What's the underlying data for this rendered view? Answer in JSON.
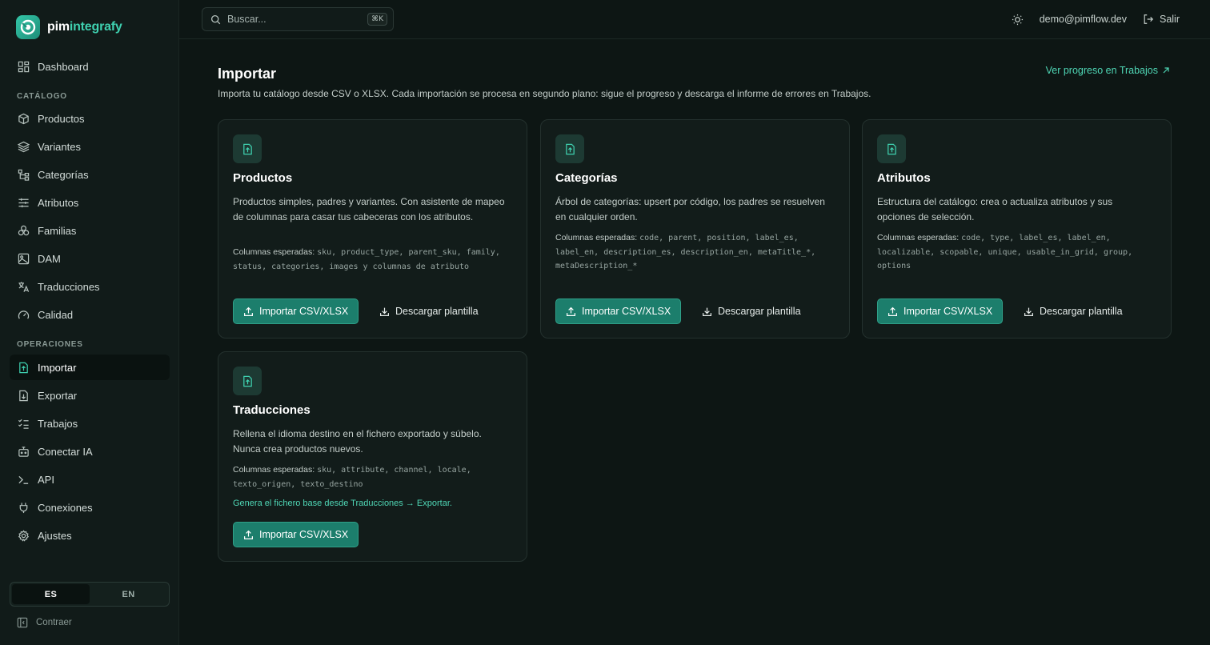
{
  "app": {
    "brand_a": "pim",
    "brand_b": "integrafy"
  },
  "sidebar": {
    "dashboard": "Dashboard",
    "section_catalog": "CATÁLOGO",
    "catalog_items": [
      "Productos",
      "Variantes",
      "Categorías",
      "Atributos",
      "Familias",
      "DAM",
      "Traducciones",
      "Calidad"
    ],
    "section_ops": "OPERACIONES",
    "ops_items": [
      "Importar",
      "Exportar",
      "Trabajos",
      "Conectar IA",
      "API",
      "Conexiones",
      "Ajustes"
    ],
    "active_item": "Importar",
    "lang": {
      "es": "ES",
      "en": "EN",
      "selected": "ES"
    },
    "collapse_label": "Contraer"
  },
  "topbar": {
    "search_placeholder": "Buscar...",
    "search_shortcut": "⌘K",
    "user_email": "demo@pimflow.dev",
    "logout_label": "Salir"
  },
  "page": {
    "title": "Importar",
    "description": "Importa tu catálogo desde CSV o XLSX. Cada importación se procesa en segundo plano: sigue el progreso y descarga el informe de errores en Trabajos.",
    "progress_link": "Ver progreso en Trabajos"
  },
  "cards": [
    {
      "title": "Productos",
      "description": "Productos simples, padres y variantes. Con asistente de mapeo de columnas para casar tus cabeceras con los atributos.",
      "columns_label": "Columnas esperadas:",
      "columns": "sku, product_type, parent_sku, family, status, categories, images y columnas de atributo",
      "import_label": "Importar CSV/XLSX",
      "template_label": "Descargar plantilla"
    },
    {
      "title": "Categorías",
      "description": "Árbol de categorías: upsert por código, los padres se resuelven en cualquier orden.",
      "columns_label": "Columnas esperadas:",
      "columns": "code, parent, position, label_es, label_en, description_es, description_en, metaTitle_*, metaDescription_*",
      "import_label": "Importar CSV/XLSX",
      "template_label": "Descargar plantilla"
    },
    {
      "title": "Atributos",
      "description": "Estructura del catálogo: crea o actualiza atributos y sus opciones de selección.",
      "columns_label": "Columnas esperadas:",
      "columns": "code, type, label_es, label_en, localizable, scopable, unique, usable_in_grid, group, options",
      "import_label": "Importar CSV/XLSX",
      "template_label": "Descargar plantilla"
    },
    {
      "title": "Traducciones",
      "description": "Rellena el idioma destino en el fichero exportado y súbelo. Nunca crea productos nuevos.",
      "columns_label": "Columnas esperadas:",
      "columns": "sku, attribute, channel, locale, texto_origen, texto_destino",
      "note": "Genera el fichero base desde Traducciones → Exportar.",
      "import_label": "Importar CSV/XLSX"
    }
  ],
  "colors": {
    "accent": "#3fd1b0",
    "primary_button": "#1c7e6c",
    "background": "#0d1614",
    "card": "#121c1a"
  }
}
